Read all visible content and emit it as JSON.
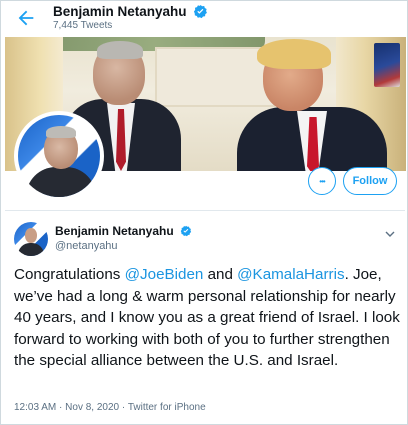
{
  "header": {
    "name": "Benjamin Netanyahu",
    "tweet_count": "7,445 Tweets"
  },
  "profile": {
    "follow_label": "Follow",
    "more_label": "•••"
  },
  "tweet": {
    "author_name": "Benjamin Netanyahu",
    "handle": "@netanyahu",
    "text_before": "Congratulations ",
    "mention_1": "@JoeBiden",
    "text_middle": " and ",
    "mention_2": "@KamalaHarris",
    "text_after": ". Joe, we’ve had a long & warm personal relationship for nearly 40 years, and I know you as a great friend of Israel. I look forward to working with both of you to further strengthen the special alliance between the U.S. and Israel.",
    "time": "12:03 AM",
    "separator_1": " · ",
    "date": "Nov 8, 2020",
    "separator_2": " · ",
    "source": "Twitter for iPhone"
  },
  "colors": {
    "accent": "#1da1f2",
    "mention": "#1b95e0",
    "secondary_text": "#5b7083"
  },
  "icons": {
    "back": "arrow-left-icon",
    "verified": "verified-badge-icon",
    "more": "more-horizontal-icon",
    "caret": "chevron-down-icon"
  }
}
